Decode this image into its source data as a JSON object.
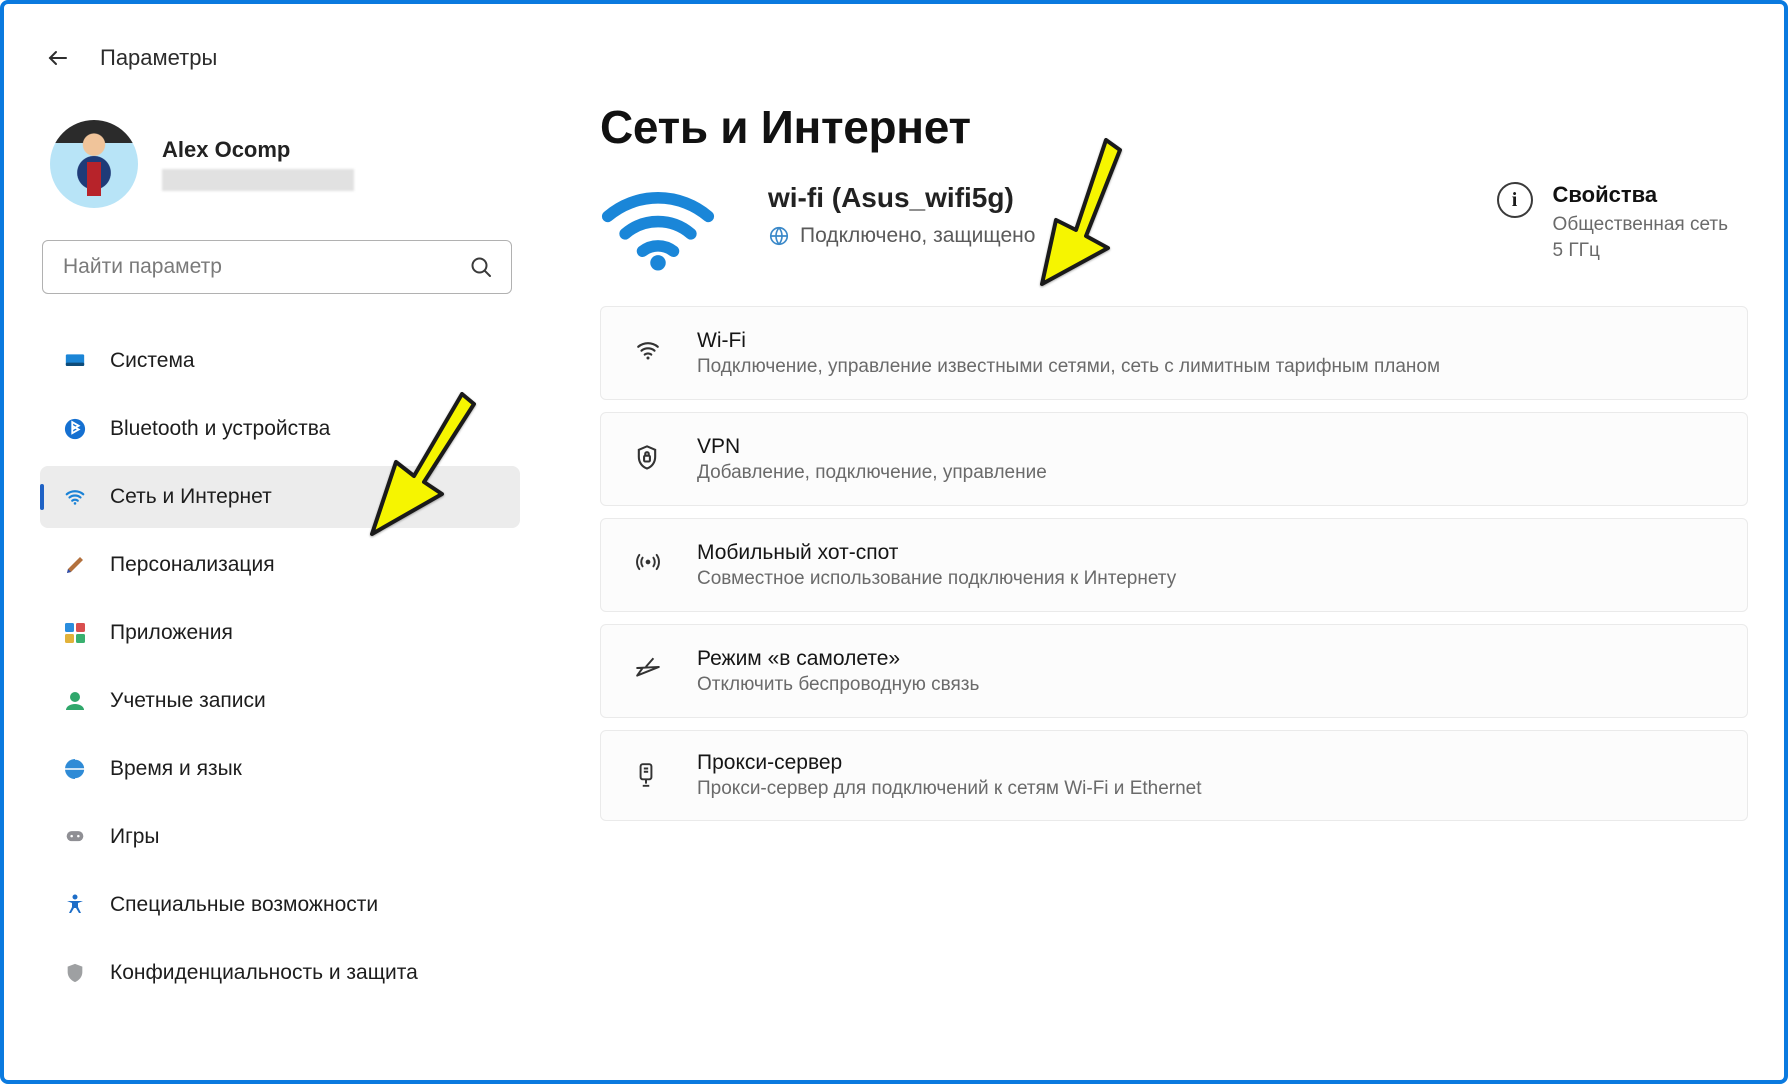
{
  "header": {
    "app_title": "Параметры"
  },
  "user": {
    "name": "Alex Ocomp"
  },
  "search": {
    "placeholder": "Найти параметр"
  },
  "sidebar": {
    "items": [
      {
        "label": "Система",
        "icon": "system"
      },
      {
        "label": "Bluetooth и устройства",
        "icon": "bluetooth"
      },
      {
        "label": "Сеть и Интернет",
        "icon": "wifi",
        "active": true
      },
      {
        "label": "Персонализация",
        "icon": "brush"
      },
      {
        "label": "Приложения",
        "icon": "apps"
      },
      {
        "label": "Учетные записи",
        "icon": "account"
      },
      {
        "label": "Время и язык",
        "icon": "time"
      },
      {
        "label": "Игры",
        "icon": "games"
      },
      {
        "label": "Специальные возможности",
        "icon": "accessibility"
      },
      {
        "label": "Конфиденциальность и защита",
        "icon": "shield"
      }
    ]
  },
  "page": {
    "title": "Сеть и Интернет",
    "connection": {
      "name": "wi-fi (Asus_wifi5g)",
      "status": "Подключено, защищено"
    },
    "properties": {
      "title": "Свойства",
      "line1": "Общественная сеть",
      "line2": "5 ГГц"
    },
    "cards": [
      {
        "title": "Wi-Fi",
        "sub": "Подключение, управление известными сетями, сеть с лимитным тарифным планом",
        "icon": "wifi-sm"
      },
      {
        "title": "VPN",
        "sub": "Добавление, подключение, управление",
        "icon": "vpn"
      },
      {
        "title": "Мобильный хот-спот",
        "sub": "Совместное использование подключения к Интернету",
        "icon": "hotspot"
      },
      {
        "title": "Режим «в самолете»",
        "sub": "Отключить беспроводную связь",
        "icon": "plane"
      },
      {
        "title": "Прокси-сервер",
        "sub": "Прокси-сервер для подключений к сетям Wi-Fi и Ethernet",
        "icon": "proxy"
      }
    ]
  }
}
